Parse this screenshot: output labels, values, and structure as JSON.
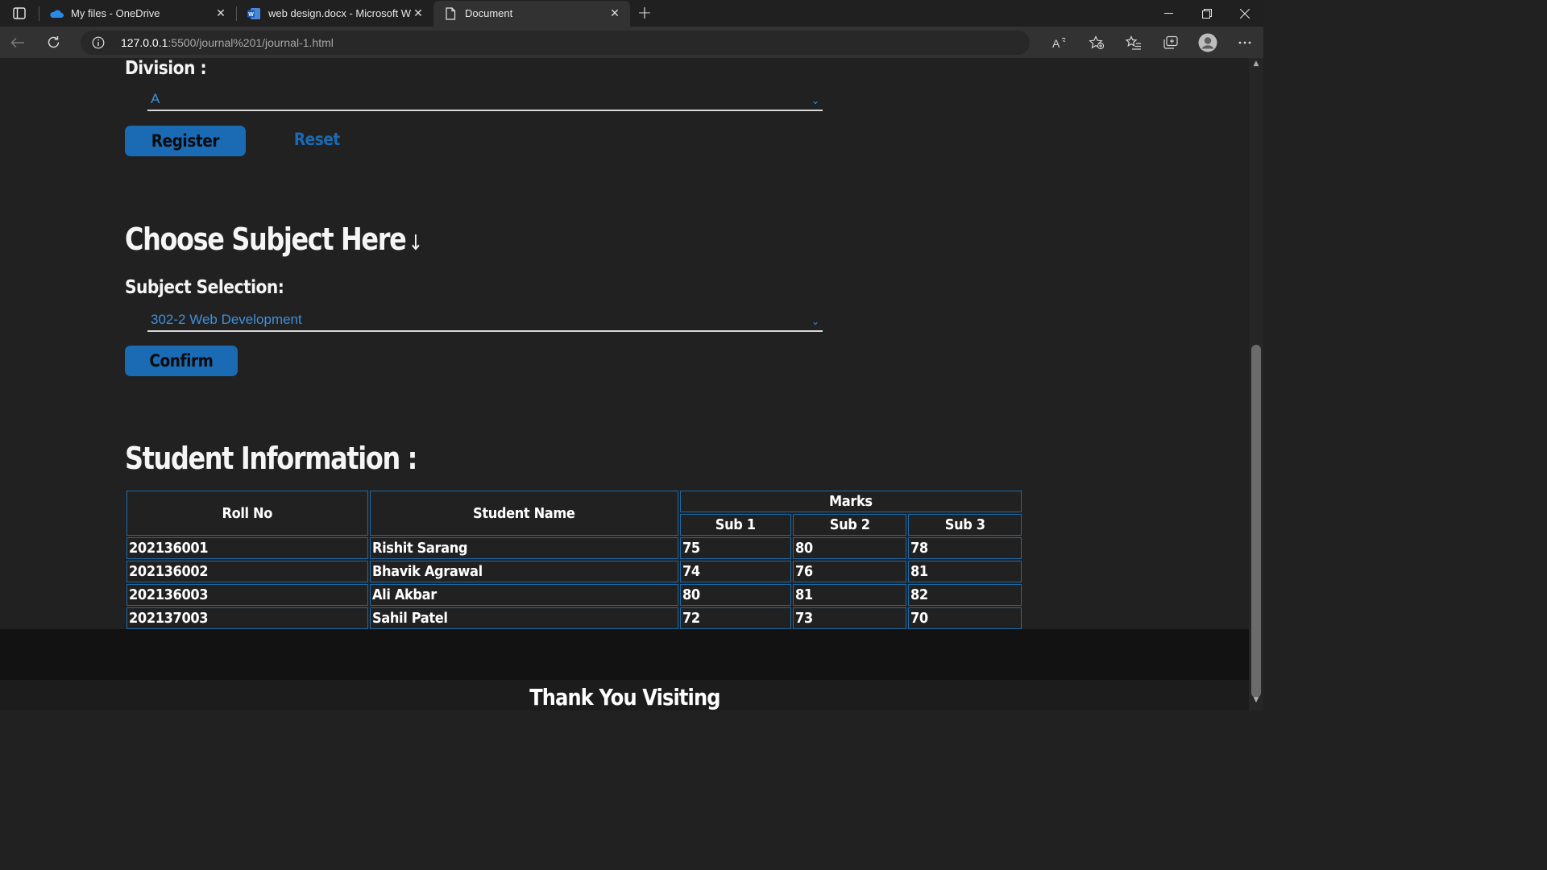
{
  "browser": {
    "tabs": [
      {
        "title": "My files - OneDrive",
        "icon": "onedrive-icon"
      },
      {
        "title": "web design.docx - Microsoft Wo",
        "icon": "word-icon"
      },
      {
        "title": "Document",
        "icon": "document-icon",
        "active": true
      }
    ],
    "url_host": "127.0.0.1",
    "url_rest": ":5500/journal%201/journal-1.html"
  },
  "page": {
    "division_label": "Division :",
    "division_value": "A",
    "register_label": "Register",
    "reset_label": "Reset",
    "subject_heading": "Choose Subject Here",
    "subject_arrow": "↓",
    "subject_label": "Subject Selection:",
    "subject_value": "302-2 Web Development",
    "confirm_label": "Confirm",
    "student_heading": "Student Information :",
    "footer_text": "Thank You Visiting"
  },
  "table": {
    "headers": {
      "roll_no": "Roll No",
      "student_name": "Student Name",
      "marks": "Marks",
      "sub1": "Sub 1",
      "sub2": "Sub 2",
      "sub3": "Sub 3"
    },
    "rows": [
      {
        "roll": "202136001",
        "name": "Rishit Sarang",
        "s1": "75",
        "s2": "80",
        "s3": "78"
      },
      {
        "roll": "202136002",
        "name": "Bhavik Agrawal",
        "s1": "74",
        "s2": "76",
        "s3": "81"
      },
      {
        "roll": "202136003",
        "name": "Ali Akbar",
        "s1": "80",
        "s2": "81",
        "s3": "82"
      },
      {
        "roll": "202137003",
        "name": "Sahil Patel",
        "s1": "72",
        "s2": "73",
        "s3": "70"
      }
    ]
  },
  "colors": {
    "accent": "#1a6bb4",
    "select_text": "#3f8fdc",
    "page_bg": "#212121",
    "footer_bg": "#121212"
  }
}
